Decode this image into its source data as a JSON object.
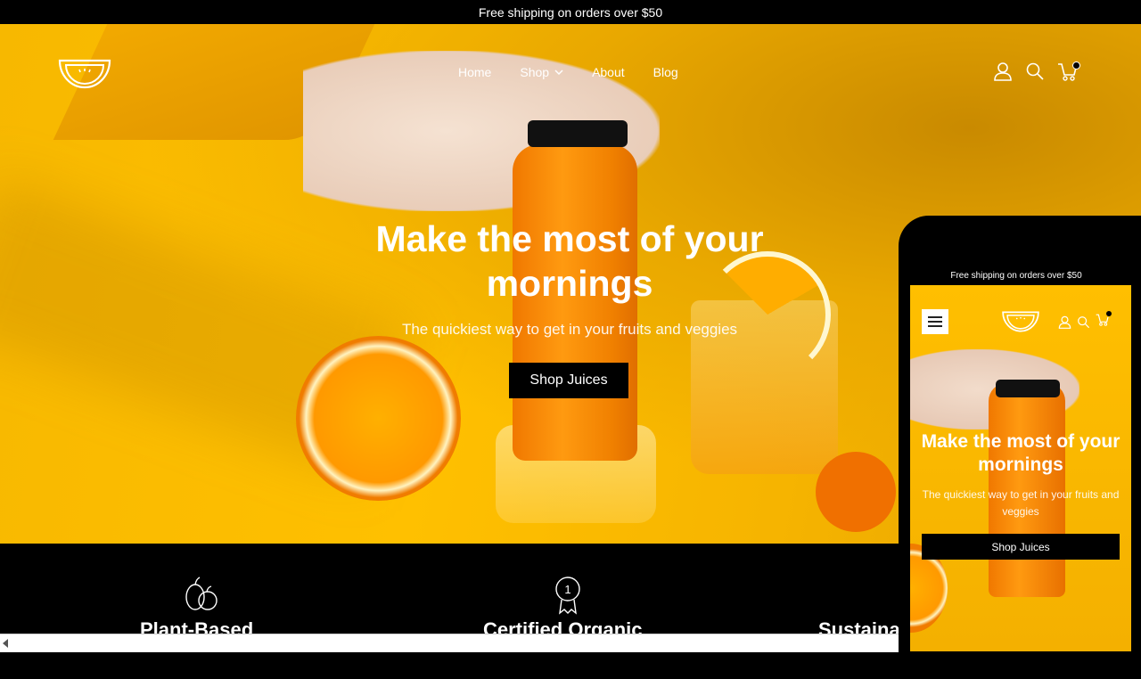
{
  "announcement": "Free shipping on orders over $50",
  "header": {
    "logo": "watermelon-smile-logo",
    "nav": [
      {
        "label": "Home"
      },
      {
        "label": "Shop",
        "has_dropdown": true
      },
      {
        "label": "About"
      },
      {
        "label": "Blog"
      }
    ],
    "icons": [
      "account-icon",
      "search-icon",
      "cart-icon"
    ],
    "cart_has_items": true
  },
  "hero": {
    "title": "Make the most of your mornings",
    "subtitle": "The quickiest way to get in your fruits and veggies",
    "cta": "Shop Juices"
  },
  "features": [
    {
      "icon": "fruit-icon",
      "title": "Plant-Based"
    },
    {
      "icon": "award-ribbon-icon",
      "icon_text": "1",
      "title": "Certified Organic"
    },
    {
      "icon": "",
      "title": "Sustainable"
    }
  ],
  "mobile_preview": {
    "announcement": "Free shipping on orders over $50",
    "title": "Make the most of your mornings",
    "subtitle": "The quickiest way to get in your fruits and veggies",
    "cta": "Shop Juices"
  },
  "colors": {
    "accent": "#FFC000",
    "dark": "#000000",
    "text_light": "#FFFFFF"
  }
}
